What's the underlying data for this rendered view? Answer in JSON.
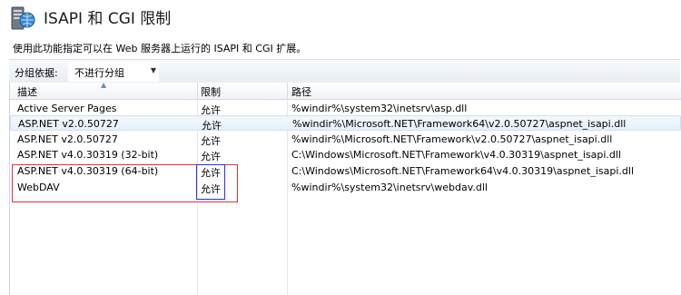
{
  "header": {
    "title": "ISAPI 和 CGI 限制",
    "icon": "server-globe-icon"
  },
  "description": "使用此功能指定可以在 Web 服务器上运行的 ISAPI 和 CGI 扩展。",
  "grouping": {
    "label": "分组依据:",
    "selected": "不进行分组"
  },
  "table": {
    "columns": [
      "描述",
      "限制",
      "路径"
    ],
    "sort_column": "描述",
    "rows": [
      {
        "desc": "Active Server Pages",
        "restriction": "允许",
        "path": "%windir%\\system32\\inetsrv\\asp.dll"
      },
      {
        "desc": "ASP.NET v2.0.50727",
        "restriction": "允许",
        "path": "%windir%\\Microsoft.NET\\Framework64\\v2.0.50727\\aspnet_isapi.dll"
      },
      {
        "desc": "ASP.NET v2.0.50727",
        "restriction": "允许",
        "path": "%windir%\\Microsoft.NET\\Framework\\v2.0.50727\\aspnet_isapi.dll"
      },
      {
        "desc": "ASP.NET v4.0.30319 (32-bit)",
        "restriction": "允许",
        "path": "C:\\Windows\\Microsoft.NET\\Framework\\v4.0.30319\\aspnet_isapi.dll"
      },
      {
        "desc": "ASP.NET v4.0.30319 (64-bit)",
        "restriction": "允许",
        "path": "C:\\Windows\\Microsoft.NET\\Framework64\\v4.0.30319\\aspnet_isapi.dll"
      },
      {
        "desc": "WebDAV",
        "restriction": "允许",
        "path": "%windir%\\system32\\inetsrv\\webdav.dll"
      }
    ]
  },
  "annotations": {
    "red_box_color": "#e0303c",
    "blue_box_color": "#2e2ee6"
  }
}
